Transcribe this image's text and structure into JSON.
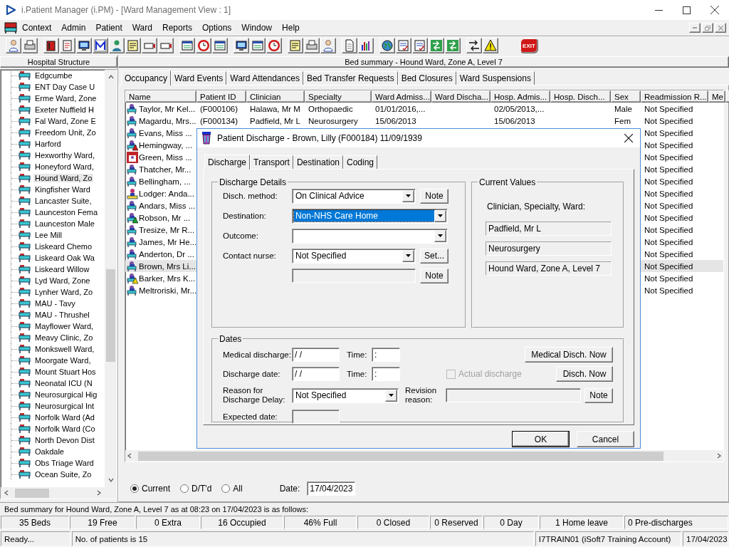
{
  "window": {
    "title": "i.Patient Manager (i.PM) - [Ward Management View : 1]"
  },
  "menu": [
    "Context",
    "Admin",
    "Patient",
    "Ward",
    "Reports",
    "Options",
    "Window",
    "Help"
  ],
  "toolbar": {
    "exit_label": "EXIT"
  },
  "hospital_structure": {
    "title": "Hospital Structure",
    "items": [
      {
        "label": "Edgcumbe",
        "selected": false
      },
      {
        "label": "ENT Day Case U",
        "selected": false
      },
      {
        "label": "Erme Ward, Zone",
        "selected": false
      },
      {
        "label": "Exeter Nuffield H",
        "selected": false
      },
      {
        "label": "Fal Ward, Zone E",
        "selected": false
      },
      {
        "label": "Freedom Unit, Zo",
        "selected": false
      },
      {
        "label": "Harford",
        "selected": false
      },
      {
        "label": "Hexworthy Ward,",
        "selected": false
      },
      {
        "label": "Honeyford Ward,",
        "selected": false
      },
      {
        "label": "Hound Ward, Zo",
        "selected": true
      },
      {
        "label": "Kingfisher Ward",
        "selected": false
      },
      {
        "label": "Lancaster Suite,",
        "selected": false
      },
      {
        "label": "Launceston Fema",
        "selected": false
      },
      {
        "label": "Launceston Male",
        "selected": false
      },
      {
        "label": "Lee Mill",
        "selected": false
      },
      {
        "label": "Liskeard Chemo",
        "selected": false
      },
      {
        "label": "Liskeard Oak Wa",
        "selected": false
      },
      {
        "label": "Liskeard Willow",
        "selected": false
      },
      {
        "label": "Lyd Ward, Zone",
        "selected": false
      },
      {
        "label": "Lynher Ward, Zo",
        "selected": false
      },
      {
        "label": "MAU - Tavy",
        "selected": false
      },
      {
        "label": "MAU - Thrushel",
        "selected": false
      },
      {
        "label": "Mayflower Ward,",
        "selected": false
      },
      {
        "label": "Meavy Clinic, Zo",
        "selected": false
      },
      {
        "label": "Monkswell Ward,",
        "selected": false
      },
      {
        "label": "Moorgate Ward,",
        "selected": false
      },
      {
        "label": "Mount Stuart Hos",
        "selected": false
      },
      {
        "label": "Neonatal ICU (N",
        "selected": false
      },
      {
        "label": "Neurosurgical Hig",
        "selected": false
      },
      {
        "label": "Neurosurgical Int",
        "selected": false
      },
      {
        "label": "Norfolk Ward (Ad",
        "selected": false
      },
      {
        "label": "Norfolk Ward (Co",
        "selected": false
      },
      {
        "label": "North Devon Dist",
        "selected": false
      },
      {
        "label": "Oakdale",
        "selected": false
      },
      {
        "label": "Obs Triage Ward",
        "selected": false
      },
      {
        "label": "Ocean Suite, Zo",
        "selected": false
      }
    ]
  },
  "ward_view": {
    "title": "Bed summary - Hound Ward, Zone A, Level 7",
    "tabs": [
      {
        "label": "Occupancy",
        "selected": true
      },
      {
        "label": "Ward Events",
        "selected": false
      },
      {
        "label": "Ward Attendances",
        "selected": false
      },
      {
        "label": "Bed Transfer Requests",
        "selected": false
      },
      {
        "label": "Bed Closures",
        "selected": false
      },
      {
        "label": "Ward Suspensions",
        "selected": false
      }
    ],
    "table": {
      "columns": [
        "Name",
        "Patient ID",
        "Clinician",
        "Specialty",
        "Ward Admiss...",
        "Ward Discha...",
        "Hosp. Admis...",
        "Hosp. Disch...",
        "Sex",
        "Readmission R...",
        "Me"
      ],
      "rows": [
        {
          "kind": "in-bed",
          "name": "Taylor, Mr Kel...",
          "patient_id": "(F000106)",
          "clinician": "Halawa, Mr M",
          "specialty": "Orthopaedic",
          "ward_admission": "01/01/2016,...",
          "hosp_admission": "02/05/2013,...",
          "sex": "Male",
          "readmission": "Not Specified",
          "selected": false
        },
        {
          "kind": "in-bed",
          "name": "Magardu, Mrs...",
          "patient_id": "(F000134)",
          "clinician": "Padfield, Mr L",
          "specialty": "Neurosurgery",
          "ward_admission": "15/06/2013",
          "hosp_admission": "15/06/2013",
          "sex": "Fem",
          "readmission": "Not Specified",
          "selected": false
        },
        {
          "kind": "in-bed",
          "name": "Evans, Miss ...",
          "readmission": "Not Specified",
          "selected": false
        },
        {
          "kind": "alert-red",
          "name": "Hemingway, ...",
          "readmission": "Not Specified",
          "selected": false
        },
        {
          "kind": "isolation",
          "name": "Green, Miss ...",
          "readmission": "Not Specified",
          "selected": false
        },
        {
          "kind": "in-bed",
          "name": "Thatcher, Mr...",
          "readmission": "Not Specified",
          "selected": false
        },
        {
          "kind": "in-bed",
          "name": "Bellingham, ...",
          "readmission": "Not Specified",
          "selected": false
        },
        {
          "kind": "seated",
          "name": "Lodger: Anda...",
          "readmission": "Not Specified",
          "selected": false
        },
        {
          "kind": "in-bed",
          "name": "Andars, Miss ...",
          "readmission": "Not Specified",
          "selected": false
        },
        {
          "kind": "alert-green",
          "name": "Robson, Mr ...",
          "readmission": "Not Specified",
          "selected": false
        },
        {
          "kind": "in-bed",
          "name": "Tresize, Mr R...",
          "readmission": "Not Specified",
          "selected": false
        },
        {
          "kind": "in-bed",
          "name": "James, Mr He...",
          "readmission": "Not Specified",
          "selected": false
        },
        {
          "kind": "in-bed",
          "name": "Anderton, Dr ...",
          "readmission": "Not Specified",
          "selected": false
        },
        {
          "kind": "in-bed",
          "name": "Brown, Mrs Li...",
          "readmission": "Not Specified",
          "selected": true
        },
        {
          "kind": "alert-yellow",
          "name": "Barker, Mrs K...",
          "readmission": "Not Specified",
          "selected": false
        },
        {
          "kind": "in-bed",
          "name": "Meltroriski, Mr...",
          "readmission": "Not Specified",
          "selected": false
        }
      ]
    },
    "filter": {
      "options": [
        {
          "label": "Current",
          "selected": true
        },
        {
          "label": "D/T'd",
          "selected": false
        },
        {
          "label": "All",
          "selected": false
        }
      ],
      "date_label": "Date:",
      "date": "17/04/2023"
    }
  },
  "summary": "Bed summary for Hound Ward, Zone A, Level 7 as at 08:23 on 17/04/2023 is as follows:",
  "counts": [
    "35 Beds",
    "19 Free",
    "0 Extra",
    "16 Occupied",
    "46% Full",
    "0 Closed",
    "0 Reserved",
    "0 Day",
    "1 Home leave",
    "0 Pre-discharges"
  ],
  "status_bar": [
    "Ready...",
    "No. of patients is 15",
    "I7TRAIN01 (iSoft7 Training Account)",
    "17/04/2023"
  ],
  "dialog": {
    "title": "Patient Discharge - Brown, Lilly (F000184) 11/09/1939",
    "tabs": [
      {
        "label": "Discharge",
        "selected": true
      },
      {
        "label": "Transport",
        "selected": false
      },
      {
        "label": "Destination",
        "selected": false
      },
      {
        "label": "Coding",
        "selected": false
      }
    ],
    "discharge_details": {
      "title": "Discharge Details",
      "method": {
        "label": "Disch. method:",
        "value": "On Clinical Advice",
        "note_button": "Note"
      },
      "destination": {
        "label": "Destination:",
        "value": "Non-NHS Care Home",
        "focused": true
      },
      "outcome": {
        "label": "Outcome:"
      },
      "contact_nurse": {
        "label": "Contact nurse:",
        "value": "Not Specified",
        "set_button": "Set..."
      },
      "contact_note": {
        "disabled": true,
        "note_button": "Note"
      }
    },
    "current_values": {
      "title": "Current Values",
      "caption": "Clinician, Specialty, Ward:",
      "values": [
        "Padfield, Mr L",
        "Neurosurgery",
        "Hound Ward, Zone A, Level 7"
      ]
    },
    "dates": {
      "title": "Dates",
      "medical_discharge": {
        "label": "Medical discharge:",
        "value": "/ /",
        "time_label": "Time:",
        "time": ":"
      },
      "discharge_date": {
        "label": "Discharge date:",
        "value": "/ /",
        "time_label": "Time:",
        "time": ":"
      },
      "medical_now_button": "Medical Disch. Now",
      "actual_discharge": {
        "label": "Actual discharge",
        "checked": false,
        "disabled": true
      },
      "disch_now_button": "Disch. Now",
      "delay": {
        "label": "Reason for Discharge Delay:",
        "value": "Not Specified"
      },
      "revision": {
        "label": "Revision reason:",
        "disabled": true,
        "note_button": "Note"
      },
      "expected": {
        "label": "Expected date:",
        "disabled": true
      }
    },
    "buttons": [
      {
        "label": "OK",
        "default": true
      },
      {
        "label": "Cancel",
        "default": false
      }
    ]
  }
}
